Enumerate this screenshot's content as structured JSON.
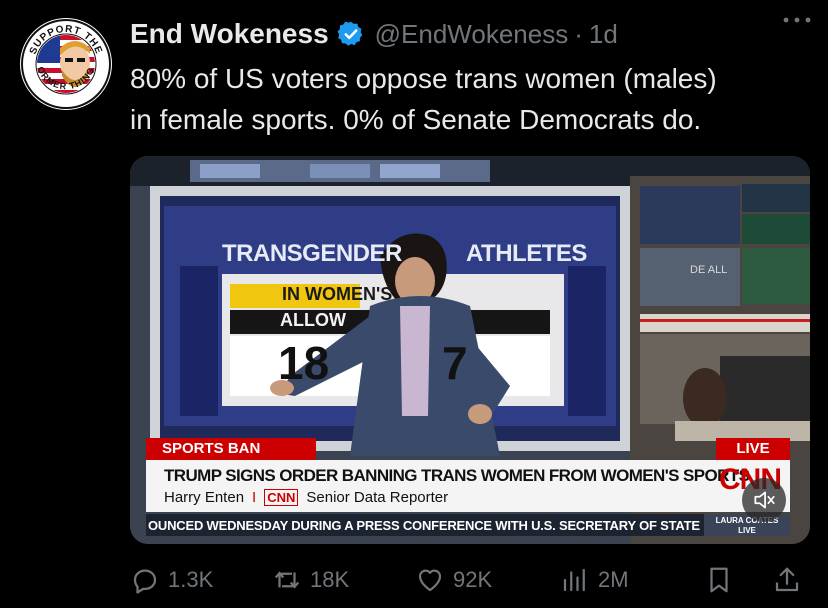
{
  "tweet": {
    "display_name": "End Wokeness",
    "handle": "@EndWokeness",
    "separator": "·",
    "time": "1d",
    "text_line1": "80% of US voters oppose trans women (males)",
    "text_line2": "in female sports. 0% of Senate Democrats do.",
    "avatar_text_top": "SUPPORT THE",
    "avatar_text_bottom": "FORMER THINGS"
  },
  "video": {
    "screen_title_a": "TRANSGENDER",
    "screen_title_b": "ATHLETES",
    "screen_subtitle": "IN WOMEN'S",
    "screen_row_label": "ALLOW",
    "screen_value_left": "18",
    "screen_value_right": "7",
    "monitor_text": "DE ALL",
    "chyron_tag": "SPORTS BAN",
    "live_label": "LIVE",
    "headline": "TRUMP SIGNS ORDER BANNING TRANS WOMEN FROM WOMEN'S SPORTS",
    "reporter_name": "Harry Enten",
    "reporter_sep": "I",
    "network_small": "CNN",
    "reporter_title": "Senior Data Reporter",
    "network_logo": "CNN",
    "ticker": "OUNCED WEDNESDAY DURING A PRESS CONFERENCE WITH U.S. SECRETARY OF STATE",
    "show_name": "LAURA COATES",
    "show_live": "LIVE"
  },
  "actions": {
    "replies": "1.3K",
    "reposts": "18K",
    "likes": "92K",
    "views": "2M"
  },
  "colors": {
    "verified_blue": "#1d9bf0",
    "muted_text": "#71767b",
    "cnn_red": "#cc0000",
    "background": "#000000"
  },
  "icons": {
    "verified": "verified-badge-icon",
    "more": "more-dots-icon",
    "reply": "reply-icon",
    "repost": "repost-icon",
    "like": "heart-icon",
    "views": "views-chart-icon",
    "bookmark": "bookmark-icon",
    "share": "share-icon",
    "mute": "muted-speaker-icon"
  }
}
